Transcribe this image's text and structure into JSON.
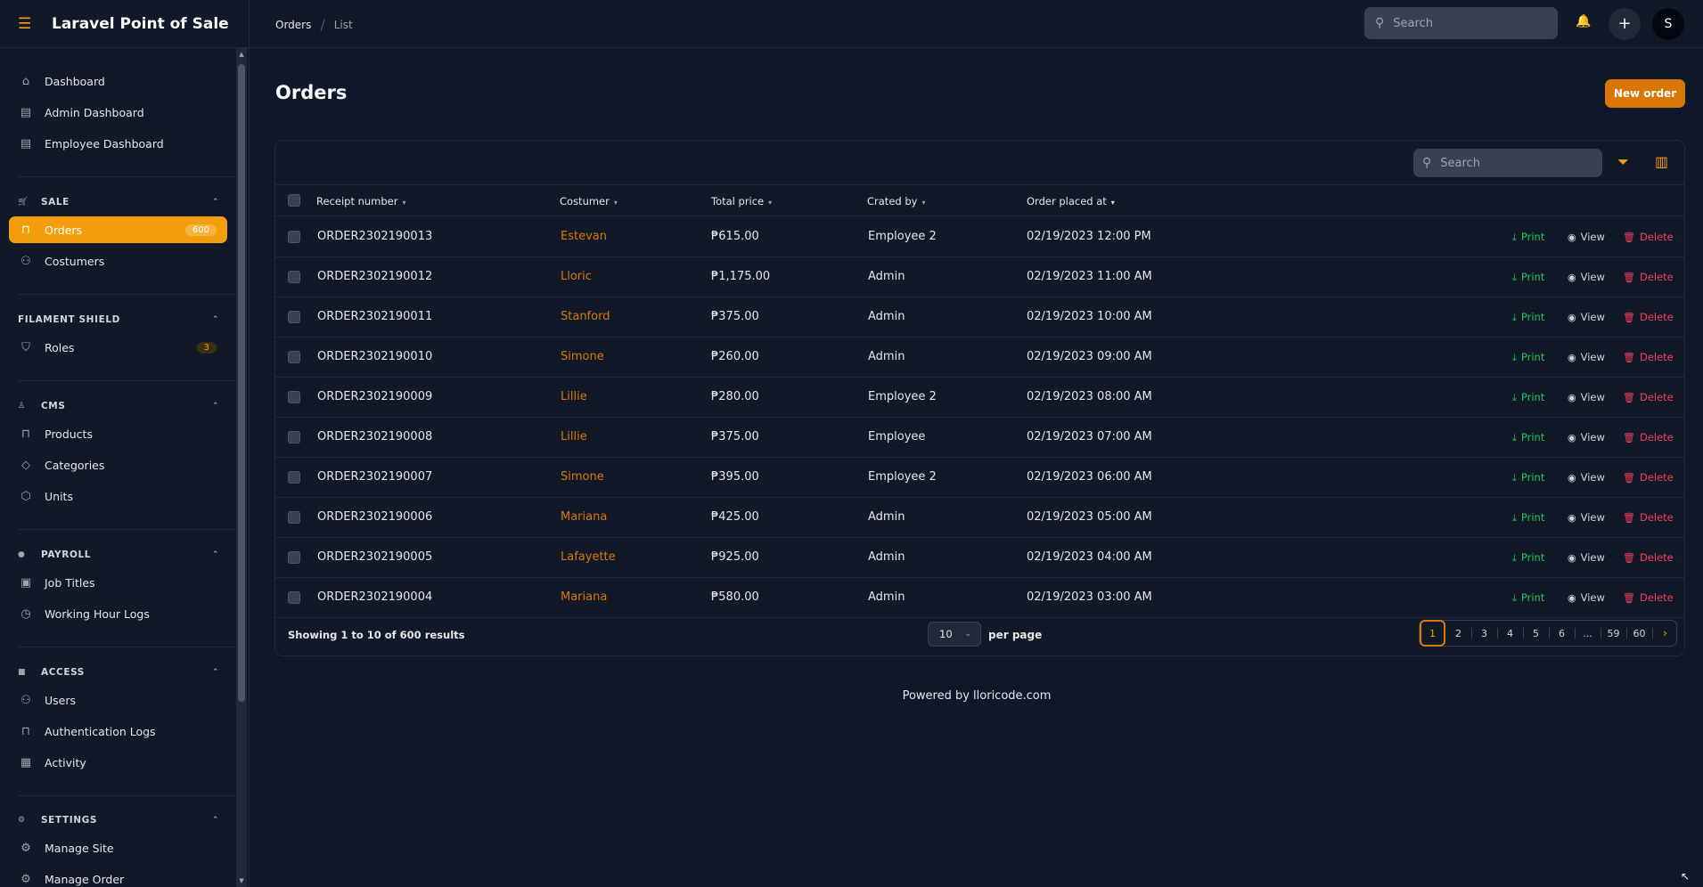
{
  "app": {
    "brand": "Laravel Point of Sale"
  },
  "sidebar": {
    "top_items": [
      {
        "label": "Dashboard"
      },
      {
        "label": "Admin Dashboard"
      },
      {
        "label": "Employee Dashboard"
      }
    ],
    "groups": [
      {
        "label": "SALE",
        "items": [
          {
            "label": "Orders",
            "badge": "600"
          },
          {
            "label": "Costumers"
          }
        ]
      },
      {
        "label": "FILAMENT SHIELD",
        "items": [
          {
            "label": "Roles",
            "badge": "3"
          }
        ]
      },
      {
        "label": "CMS",
        "items": [
          {
            "label": "Products"
          },
          {
            "label": "Categories"
          },
          {
            "label": "Units"
          }
        ]
      },
      {
        "label": "PAYROLL",
        "items": [
          {
            "label": "Job Titles"
          },
          {
            "label": "Working Hour Logs"
          }
        ]
      },
      {
        "label": "ACCESS",
        "items": [
          {
            "label": "Users"
          },
          {
            "label": "Authentication Logs"
          },
          {
            "label": "Activity"
          }
        ]
      },
      {
        "label": "SETTINGS",
        "items": [
          {
            "label": "Manage Site"
          },
          {
            "label": "Manage Order"
          }
        ]
      }
    ]
  },
  "topbar": {
    "breadcrumbs": [
      "Orders",
      "List"
    ],
    "search_placeholder": "Search",
    "avatar_initial": "S"
  },
  "page": {
    "title": "Orders",
    "new_button": "New order"
  },
  "table": {
    "search_placeholder": "Search",
    "columns": [
      "Receipt number",
      "Costumer",
      "Total price",
      "Crated by",
      "Order placed at"
    ],
    "actions": {
      "print": "Print",
      "view": "View",
      "delete": "Delete"
    },
    "rows": [
      {
        "receipt": "ORDER2302190013",
        "customer": "Estevan",
        "total": "₱615.00",
        "created_by": "Employee 2",
        "placed_at": "02/19/2023 12:00 PM"
      },
      {
        "receipt": "ORDER2302190012",
        "customer": "Lloric",
        "total": "₱1,175.00",
        "created_by": "Admin",
        "placed_at": "02/19/2023 11:00 AM"
      },
      {
        "receipt": "ORDER2302190011",
        "customer": "Stanford",
        "total": "₱375.00",
        "created_by": "Admin",
        "placed_at": "02/19/2023 10:00 AM"
      },
      {
        "receipt": "ORDER2302190010",
        "customer": "Simone",
        "total": "₱260.00",
        "created_by": "Admin",
        "placed_at": "02/19/2023 09:00 AM"
      },
      {
        "receipt": "ORDER2302190009",
        "customer": "Lillie",
        "total": "₱280.00",
        "created_by": "Employee 2",
        "placed_at": "02/19/2023 08:00 AM"
      },
      {
        "receipt": "ORDER2302190008",
        "customer": "Lillie",
        "total": "₱375.00",
        "created_by": "Employee",
        "placed_at": "02/19/2023 07:00 AM"
      },
      {
        "receipt": "ORDER2302190007",
        "customer": "Simone",
        "total": "₱395.00",
        "created_by": "Employee 2",
        "placed_at": "02/19/2023 06:00 AM"
      },
      {
        "receipt": "ORDER2302190006",
        "customer": "Mariana",
        "total": "₱425.00",
        "created_by": "Admin",
        "placed_at": "02/19/2023 05:00 AM"
      },
      {
        "receipt": "ORDER2302190005",
        "customer": "Lafayette",
        "total": "₱925.00",
        "created_by": "Admin",
        "placed_at": "02/19/2023 04:00 AM"
      },
      {
        "receipt": "ORDER2302190004",
        "customer": "Mariana",
        "total": "₱580.00",
        "created_by": "Admin",
        "placed_at": "02/19/2023 03:00 AM"
      }
    ],
    "footer": {
      "showing": "Showing 1 to 10 of 600 results",
      "per_page_value": "10",
      "per_page_label": "per page",
      "pages": [
        "1",
        "2",
        "3",
        "4",
        "5",
        "6",
        "...",
        "59",
        "60"
      ]
    }
  },
  "footer": {
    "text": "Powered by lloricode.com"
  },
  "colors": {
    "accent": "#f59e0b",
    "print": "#22c55e",
    "delete": "#f43f5e",
    "background": "#0f172a"
  }
}
